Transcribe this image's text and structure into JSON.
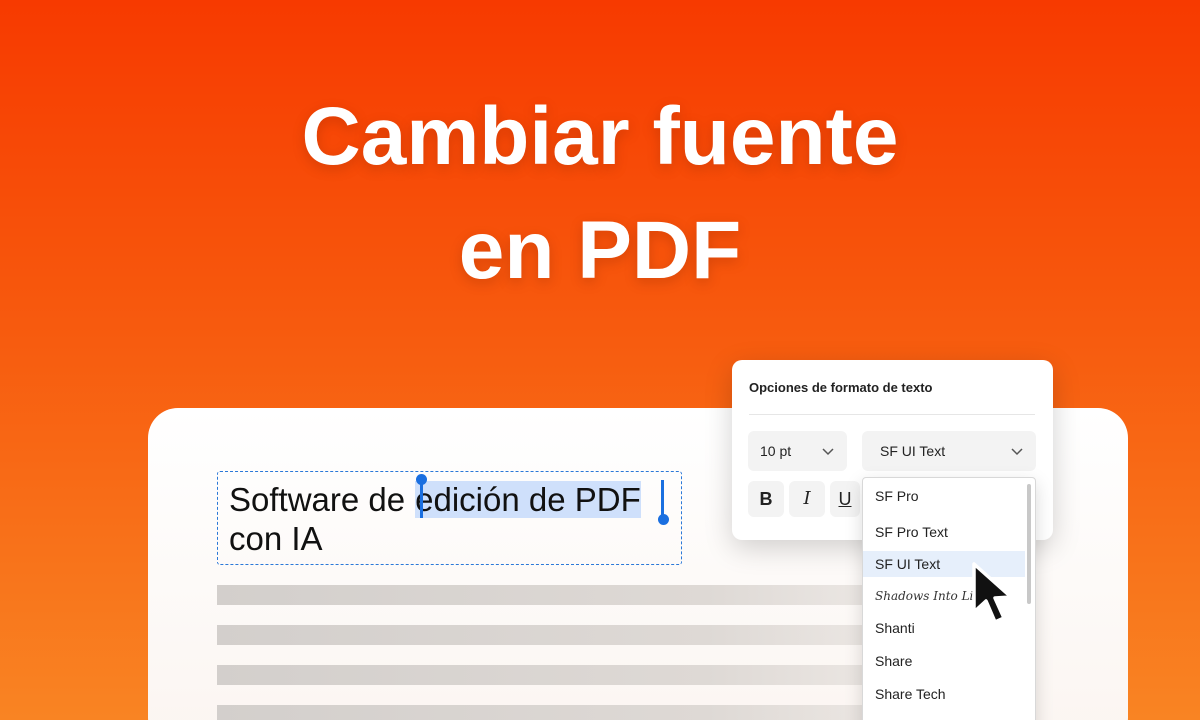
{
  "headline": {
    "line1": "Cambiar fuente",
    "line2": "en PDF"
  },
  "document": {
    "text_before_selection": "Software de",
    "selected_text": "edición de PDF",
    "line2": "con IA"
  },
  "panel": {
    "title": "Opciones de formato de texto",
    "size_value": "10 pt",
    "font_value": "SF UI Text",
    "bold_label": "B",
    "italic_label": "I",
    "underline_label": "U"
  },
  "font_list": {
    "items": [
      "SF Pro",
      "SF Pro Text",
      "SF UI Text",
      "Shadows Into Light",
      "Shanti",
      "Share",
      "Share Tech"
    ],
    "selected": "SF UI Text"
  },
  "colors": {
    "accent": "#1a6fe0",
    "background_top": "#f73a00",
    "background_bottom": "#f98423"
  },
  "icons": [
    "chevron-down-icon",
    "cursor-arrow-icon"
  ]
}
